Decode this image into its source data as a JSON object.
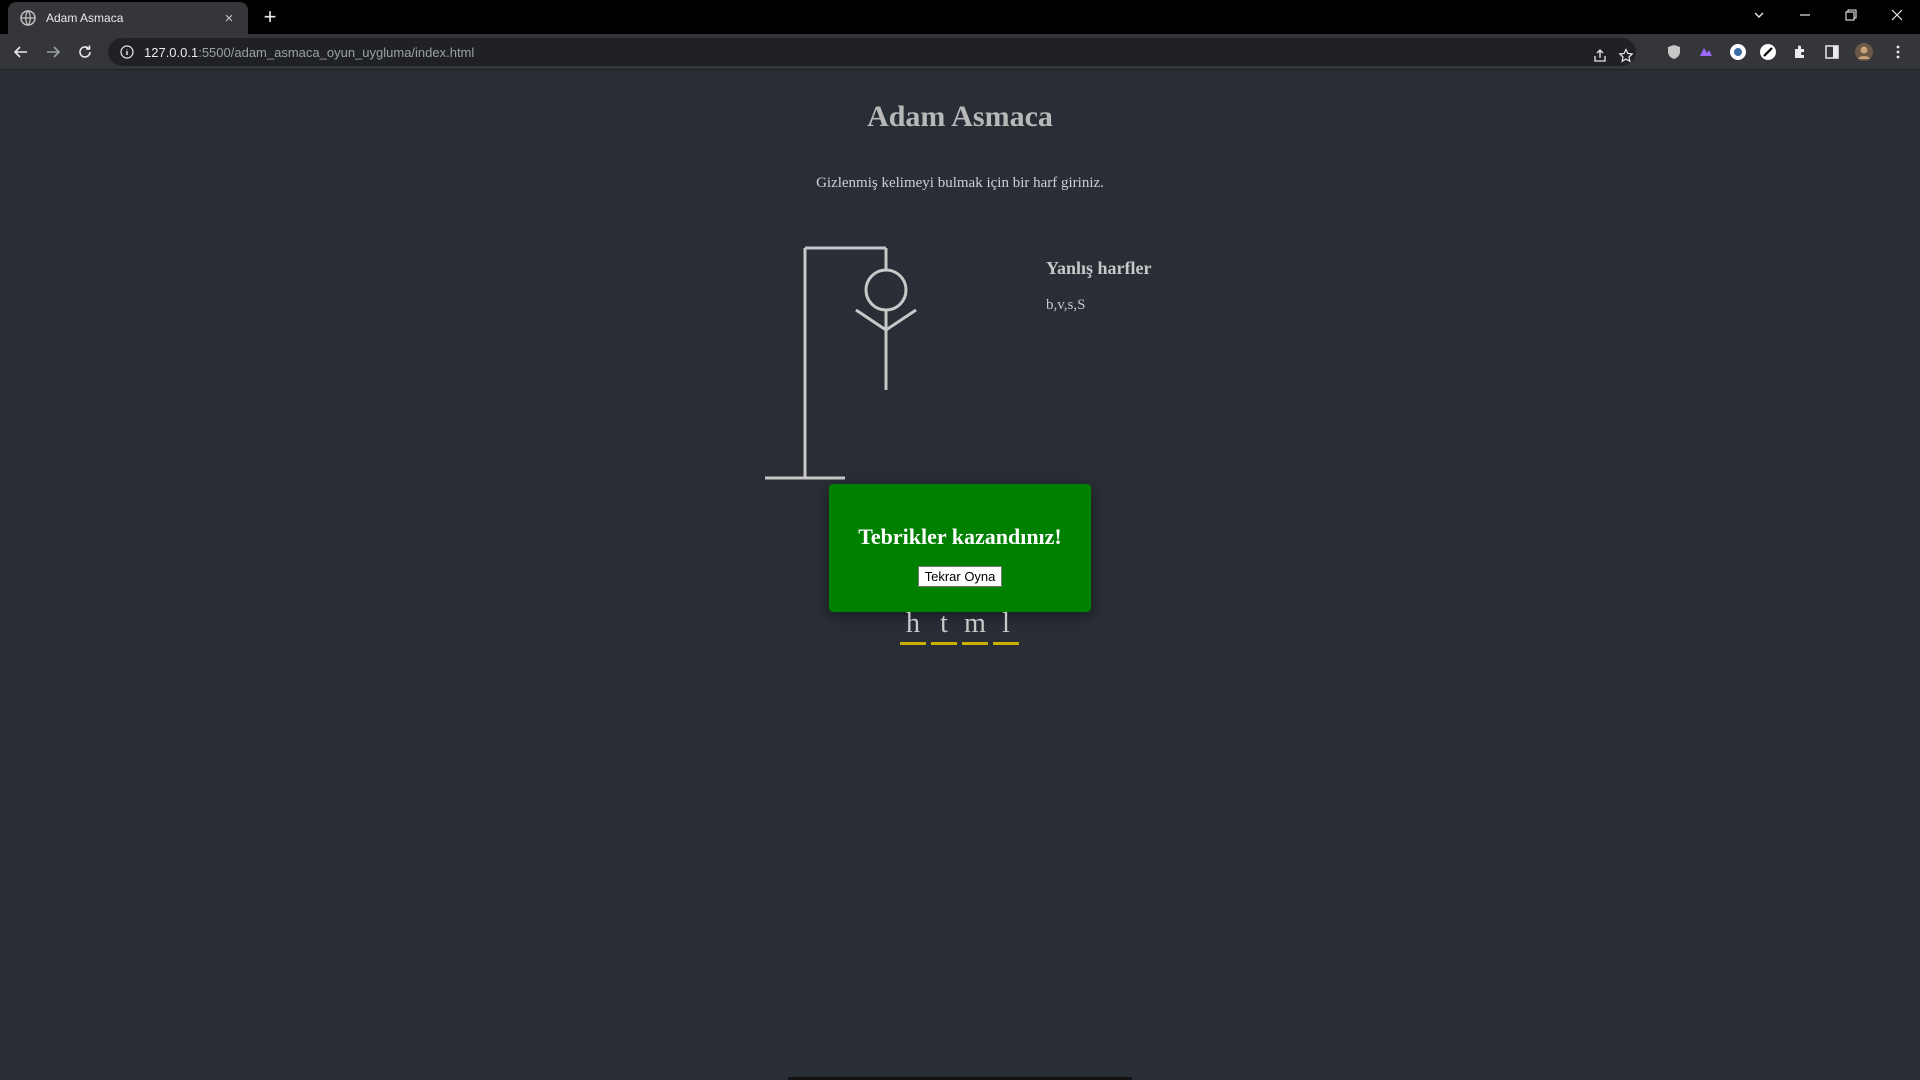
{
  "browser": {
    "tab_title": "Adam Asmaca",
    "tab_close": "×",
    "new_tab": "+",
    "url_host": "127.0.0.1",
    "url_rest": ":5500/adam_asmaca_oyun_uygluma/index.html"
  },
  "game": {
    "title": "Adam Asmaca",
    "instructions": "Gizlenmiş kelimeyi bulmak için bir harf giriniz.",
    "wrong_letters_title": "Yanlış harfler",
    "wrong_letters": "b,v,s,S",
    "word_letters": [
      "h",
      "t",
      "m",
      "l"
    ]
  },
  "popup": {
    "message": "Tebrikler kazandınız!",
    "button_label": "Tekrar Oyna",
    "background": "#008000"
  },
  "colors": {
    "page_bg": "#282d36",
    "letter_underline": "#c9b000",
    "figure": "#c8c8c8"
  }
}
